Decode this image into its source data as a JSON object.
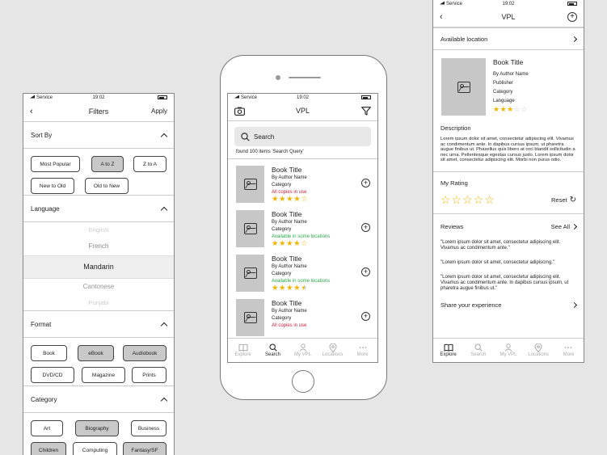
{
  "status": {
    "carrier": "Service",
    "time": "19:02"
  },
  "filters": {
    "title": "Filters",
    "apply": "Apply",
    "sort": {
      "label": "Sort By",
      "options": [
        "Most Popular",
        "A to Z",
        "Z to A",
        "New to Old",
        "Old to New"
      ],
      "selected": "A to Z"
    },
    "language": {
      "label": "Language",
      "options": [
        "English",
        "French",
        "Mandarin",
        "Cantonese",
        "Punjabi"
      ],
      "selected": "Mandarin"
    },
    "format": {
      "label": "Format",
      "options": [
        "Book",
        "eBook",
        "Audiobook",
        "DVD/CD",
        "Magazine",
        "Prints"
      ],
      "selected": [
        "eBook",
        "Audiobook"
      ]
    },
    "category": {
      "label": "Category",
      "options": [
        "Art",
        "Biography",
        "Business",
        "Children",
        "Computing",
        "Fantasy/SF"
      ],
      "selected": [
        "Biography",
        "Children",
        "Fantasy/SF"
      ]
    }
  },
  "vpl": {
    "title": "VPL",
    "search_placeholder": "Search",
    "found": "found 100 items 'Search Query'",
    "books": [
      {
        "title": "Book Title",
        "author": "By Author Name",
        "category": "Category",
        "availability": "All copies in use",
        "status": "unavailable",
        "rating": 4
      },
      {
        "title": "Book Title",
        "author": "By Author Name",
        "category": "Category",
        "availability": "Available in some locations",
        "status": "available",
        "rating": 4
      },
      {
        "title": "Book Title",
        "author": "By Author Name",
        "category": "Category",
        "availability": "Available in some locations",
        "status": "available",
        "rating": 4.5
      },
      {
        "title": "Book Title",
        "author": "By Author Name",
        "category": "Category",
        "availability": "All copies in use",
        "status": "unavailable",
        "rating": null
      }
    ],
    "tabs": [
      "Explore",
      "Search",
      "My VPL",
      "Locations",
      "More"
    ],
    "active_tab": "Search"
  },
  "detail": {
    "title": "VPL",
    "available_location": "Available location",
    "book": {
      "title": "Book Title",
      "author": "By Author Name",
      "publisher": "Publisher",
      "category": "Category",
      "language": "Language",
      "rating": 3
    },
    "description_label": "Description",
    "description": "Lorem ipsum dolor sit amet, consectetur adipiscing elit. Vivamus ac condimentum ante. In dapibus cursus ipsum, ut pharetra augue finibus ut. Phasellus quis libero at orci blandit sollicitudin a nec urna. Pellentesque egestas cursus justo. Lorem ipsum dolor sit amet, consectetur adipiscing elit. Morbi non purus odio.",
    "my_rating": "My Rating",
    "reset": "Reset",
    "reviews_label": "Reviews",
    "see_all": "See All",
    "reviews": [
      "\"Lorem ipsum dolor sit amet, consectetur adipiscing elit. Vivamus ac condimentum ante.\"",
      "\"Lorem ipsum dolor sit amet, consectetur adipiscing.\"",
      "\"Lorem ipsum dolor sit amet, consectetur adipiscing elit. Vivamus ac condimentum ante. In dapibus cursus ipsum, ut pharetra augue finibus ut.\""
    ],
    "share": "Share your experience",
    "tabs": [
      "Explore",
      "Search",
      "My VPL",
      "Locations",
      "More"
    ],
    "active_tab": "Explore"
  },
  "colors": {
    "star": "#f0b400",
    "unavailable": "#d0203a",
    "available": "#2aa84a",
    "selected_chip": "#c8c8c8"
  },
  "icons": [
    "back-icon",
    "camera-icon",
    "filter-icon",
    "search-icon",
    "add-icon",
    "image-icon",
    "chevron-up-icon",
    "chevron-right-icon",
    "reset-icon",
    "explore-icon",
    "person-icon",
    "location-pin-icon",
    "more-icon"
  ]
}
